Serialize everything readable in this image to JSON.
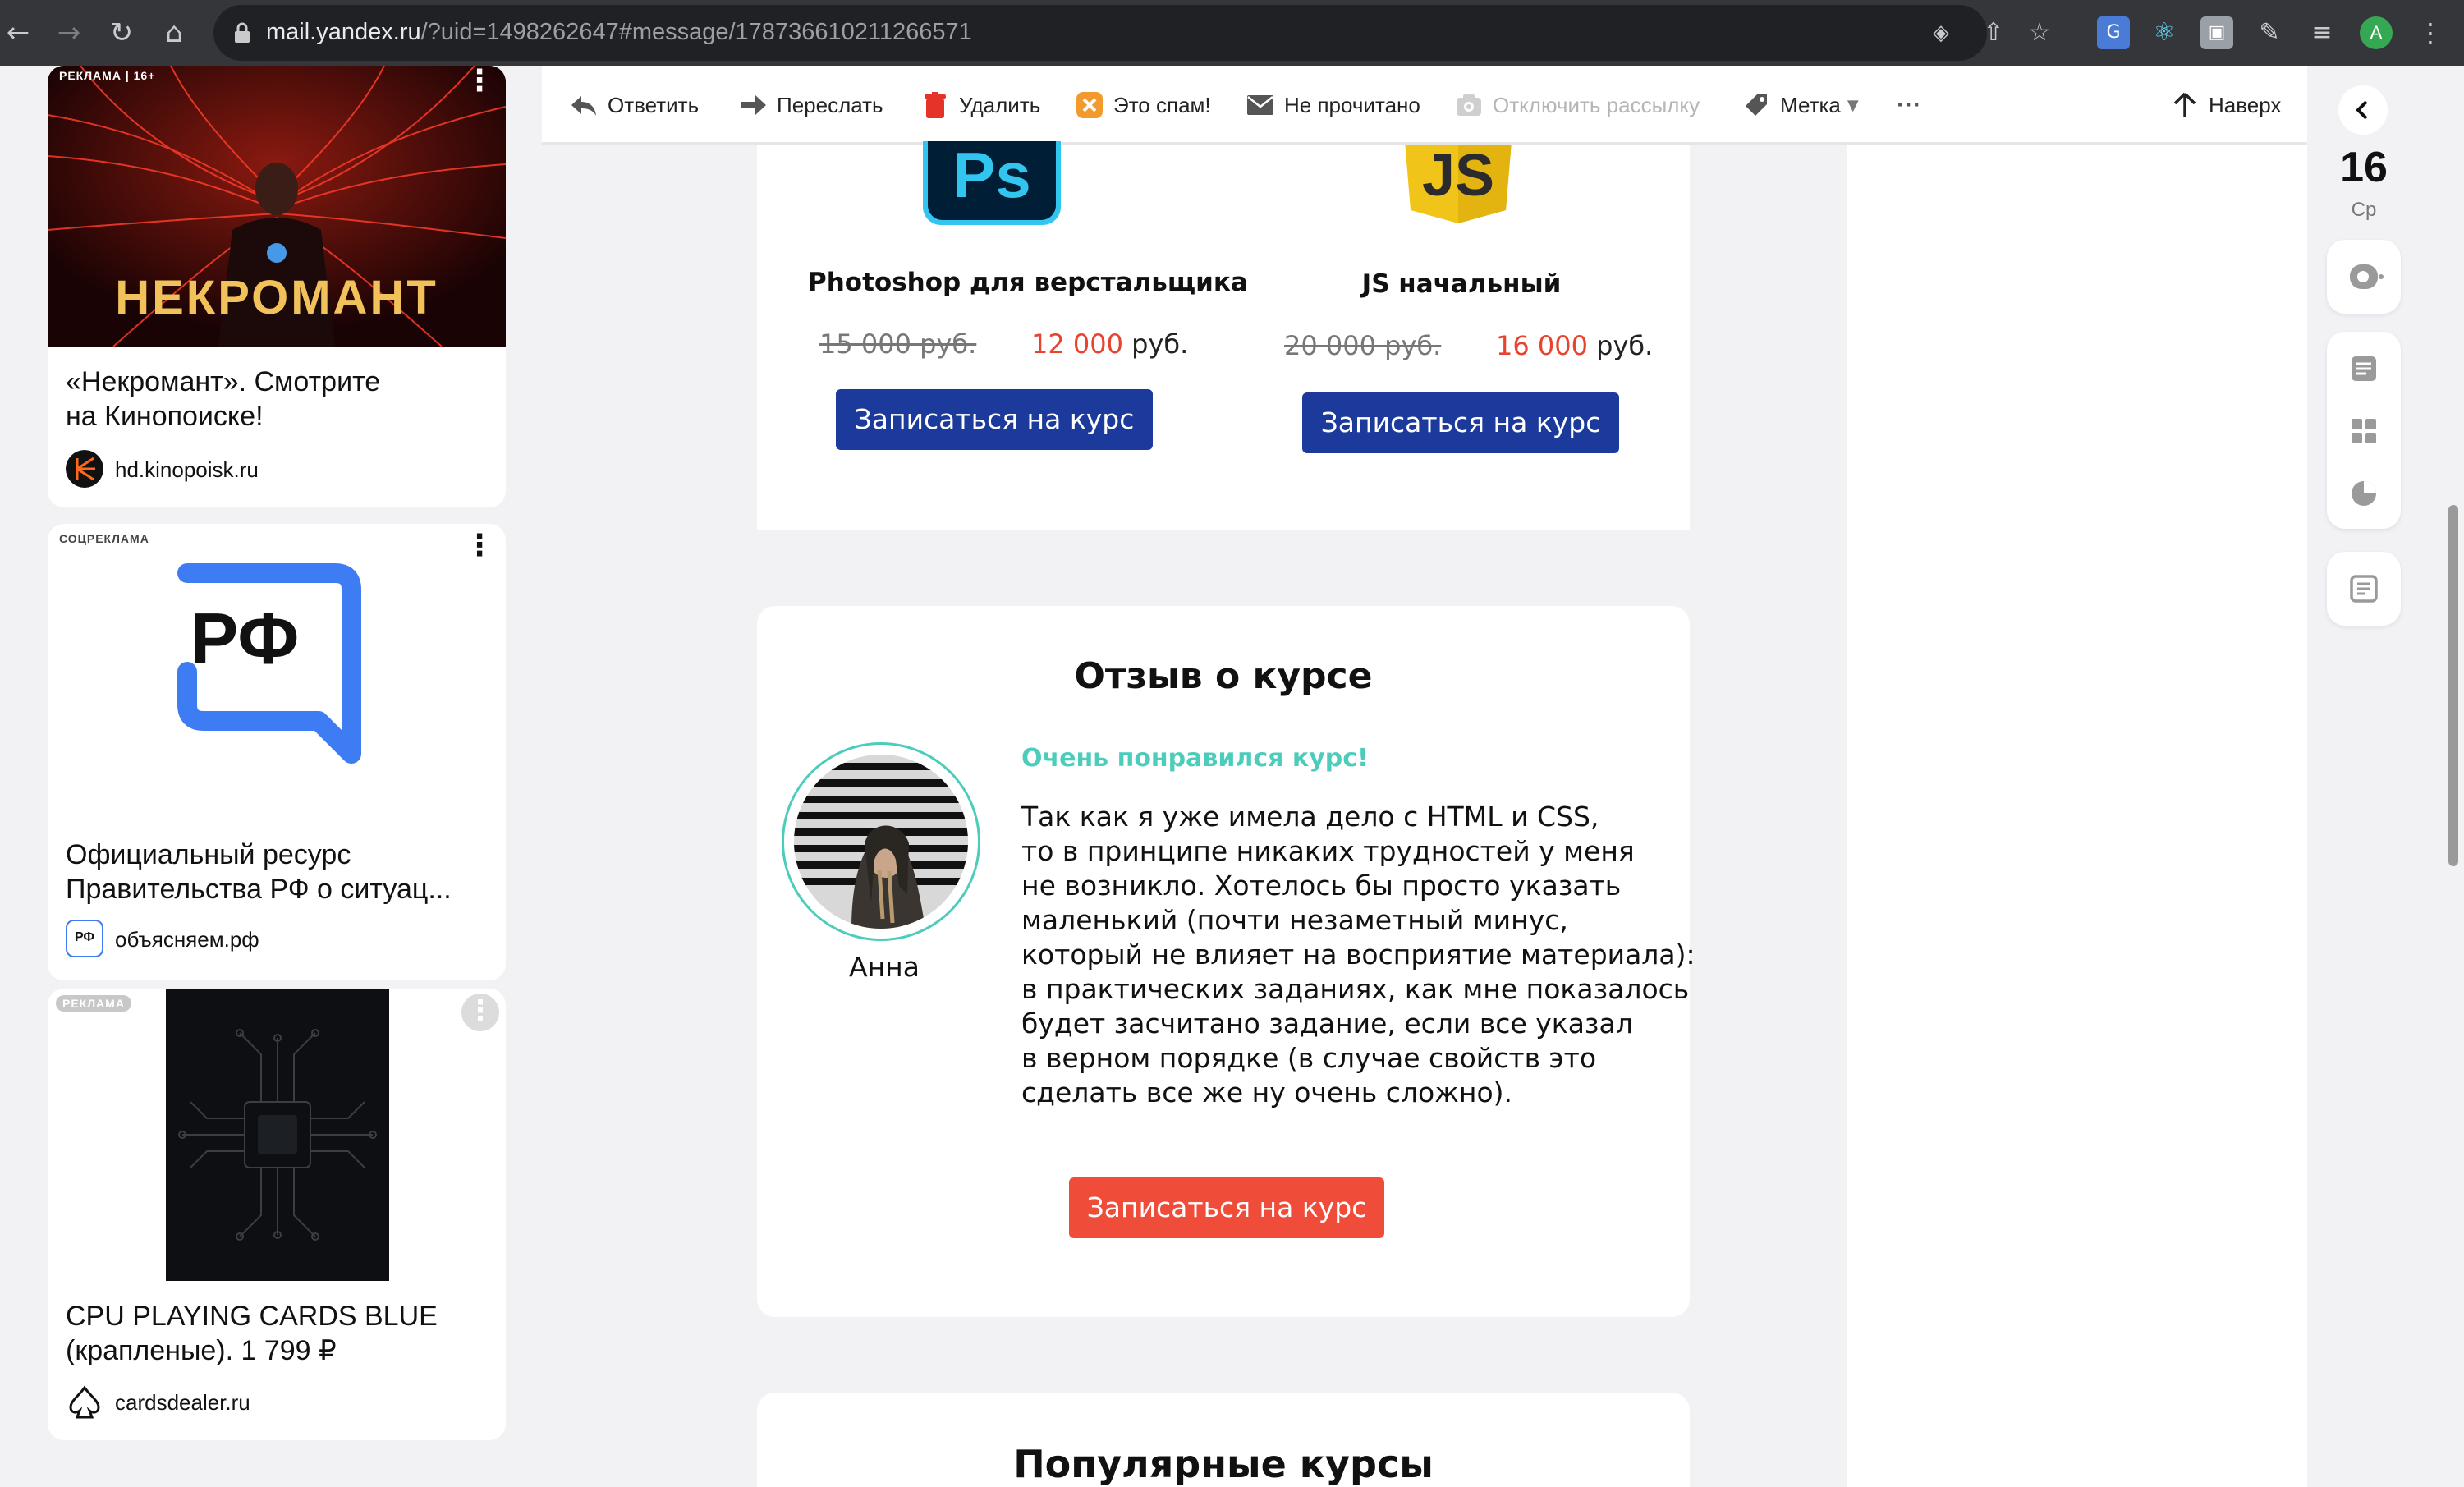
{
  "browser": {
    "url_host": "mail.yandex.ru",
    "url_rest": "/?uid=1498262647#message/178736610211266571",
    "profile_initial": "A"
  },
  "ads": [
    {
      "label": "РЕКЛАМА | 16+",
      "image_text": "НЕКРОМАНТ",
      "title_line1": "«Некромант». Смотрите",
      "title_line2": "на Кинопоиске!",
      "domain": "hd.kinopoisk.ru"
    },
    {
      "label": "СОЦРЕКЛАМА",
      "logo_text": "РФ",
      "title_line1": "Официальный ресурс",
      "title_line2": "Правительства РФ о ситуац...",
      "domain": "объясняем.рф",
      "domain_icon_text": "РФ"
    },
    {
      "label": "РЕКЛАМА",
      "title_line1": "CPU PLAYING CARDS BLUE",
      "title_line2": "(крапленые). 1 799 ₽",
      "domain": "cardsdealer.ru"
    }
  ],
  "toolbar": {
    "reply": "Ответить",
    "forward": "Переслать",
    "delete": "Удалить",
    "spam": "Это спам!",
    "unread": "Не прочитано",
    "unsubscribe": "Отключить рассылку",
    "label": "Метка",
    "more": "···",
    "top": "Наверх"
  },
  "courses": [
    {
      "logo_text": "Ps",
      "name": "Photoshop для верстальщика",
      "old_price": "15 000 руб.",
      "new_price_num": "12 000",
      "new_price_unit": " руб.",
      "button": "Записаться на курс"
    },
    {
      "logo_text": "JS",
      "name": "JS начальный",
      "old_price": "20 000 руб.",
      "new_price_num": "16 000",
      "new_price_unit": " руб.",
      "button": "Записаться на курс"
    }
  ],
  "review": {
    "title": "Отзыв о курсе",
    "tagline": "Очень понравился курс!",
    "author": "Анна",
    "lines": [
      "Так как я уже имела дело с HTML и CSS,",
      "то в принципе никаких трудностей у меня",
      "не возникло. Хотелось бы просто указать",
      "маленький (почти незаметный минус,",
      "который не влияет на восприятие материала):",
      "в практических заданиях, как мне показалось",
      "будет засчитано задание, если все указал",
      "в верном порядке (в случае свойств это",
      "сделать все же ну очень сложно)."
    ],
    "button": "Записаться на курс"
  },
  "popular": {
    "title": "Популярные курсы"
  },
  "right_panel": {
    "day": "16",
    "weekday": "Ср"
  },
  "colors": {
    "accent_blue": "#1b3a9b",
    "accent_red": "#ef4d3a",
    "accent_teal": "#4ccdbb",
    "price_red": "#e8432e"
  }
}
